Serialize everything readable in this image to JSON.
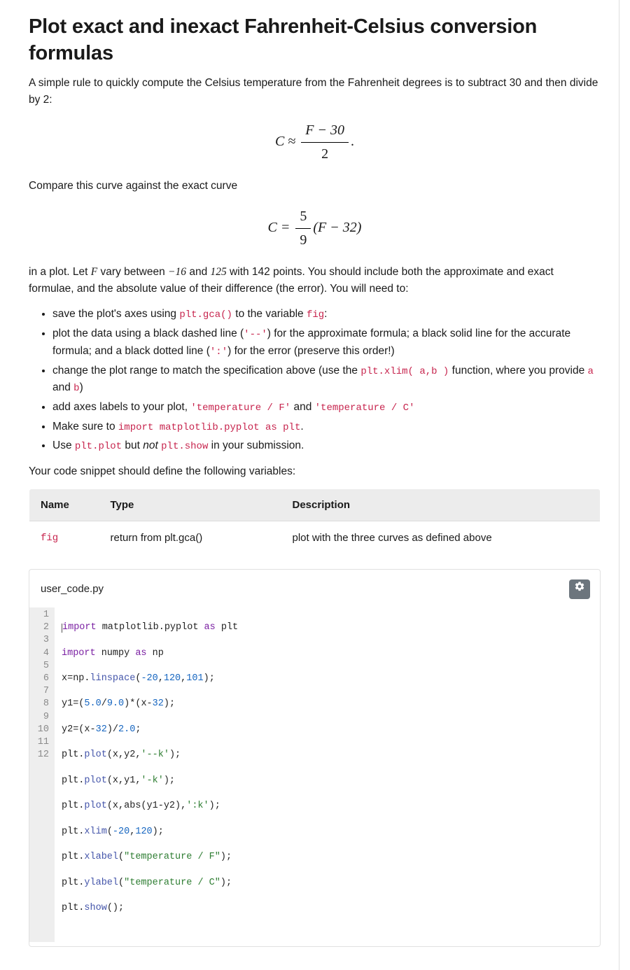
{
  "title": "Plot exact and inexact Fahrenheit-Celsius conversion formulas",
  "intro": "A simple rule to quickly compute the Celsius temperature from the Fahrenheit degrees is to subtract 30 and then divide by 2:",
  "eq1": {
    "lhs": "C ≈",
    "num": "F − 30",
    "den": "2",
    "tail": "."
  },
  "compare": "Compare this curve against the exact curve",
  "eq2": {
    "lhs": "C =",
    "num": "5",
    "den": "9",
    "rhs": "(F − 32)"
  },
  "range": {
    "pre": "in a plot. Let ",
    "var": "F",
    "mid1": " vary between ",
    "lo": "−16",
    "mid2": " and ",
    "hi": "125",
    "rest": " with 142 points. You should include both the approximate and exact formulae, and the absolute value of their difference (the error). You will need to:"
  },
  "codebits": {
    "gca": "plt.gca()",
    "fig": "fig",
    "dashes": "'--'",
    "dots": "':'",
    "xlim": "plt.xlim( a,b )",
    "a": "a",
    "b": "b",
    "lblF": "'temperature / F'",
    "lblC": "'temperature / C'",
    "import": "import matplotlib.pyplot as plt",
    "pltplot": "plt.plot",
    "pltshow": "plt.show"
  },
  "b1a": "save the plot's axes using ",
  "b1b": " to the variable ",
  "b1c": ":",
  "b2a": "plot the data using a black dashed line (",
  "b2b": ") for the approximate formula; a black solid line for the accurate formula; and a black dotted line (",
  "b2c": ") for the error (preserve this order!)",
  "b3a": "change the plot range to match the specification above (use the ",
  "b3b": " function, where you provide ",
  "b3c": " and ",
  "b3d": ")",
  "b4a": "add axes labels to your plot, ",
  "b4b": " and ",
  "b5a": "Make sure to ",
  "b5b": ".",
  "b6a": "Use ",
  "b6b": " but ",
  "b6not": "not",
  "b6c": " in your submission.",
  "define": "Your code snippet should define the following variables:",
  "table": {
    "h1": "Name",
    "h2": "Type",
    "h3": "Description",
    "r1": {
      "name": "fig",
      "type": "return from plt.gca()",
      "desc": "plot with the three curves as defined above"
    }
  },
  "file": "user_code.py",
  "lines": [
    "1",
    "2",
    "3",
    "4",
    "5",
    "6",
    "7",
    "8",
    "9",
    "10",
    "11",
    "12"
  ],
  "code": {
    "l1a": "import",
    "l1b": " matplotlib.pyplot ",
    "l1c": "as",
    "l1d": " plt",
    "l2a": "import",
    "l2b": " numpy ",
    "l2c": "as",
    "l2d": " np",
    "l3a": "x=np.",
    "l3b": "linspace",
    "l3c": "(",
    "l3n1": "-20",
    "l3d": ",",
    "l3n2": "120",
    "l3e": ",",
    "l3n3": "101",
    "l3f": ");",
    "l4a": "y1=(",
    "l4n1": "5.0",
    "l4b": "/",
    "l4n2": "9.0",
    "l4c": ")*(x-",
    "l4n3": "32",
    "l4d": ");",
    "l5a": "y2=(x-",
    "l5n1": "32",
    "l5b": ")/",
    "l5n2": "2.0",
    "l5c": ";",
    "l6a": "plt.",
    "l6b": "plot",
    "l6c": "(x,y2,",
    "l6s": "'--k'",
    "l6d": ");",
    "l7a": "plt.",
    "l7b": "plot",
    "l7c": "(x,y1,",
    "l7s": "'-k'",
    "l7d": ");",
    "l8a": "plt.",
    "l8b": "plot",
    "l8c": "(x,abs(y1-y2),",
    "l8s": "':k'",
    "l8d": ");",
    "l9a": "plt.",
    "l9b": "xlim",
    "l9c": "(",
    "l9n1": "-20",
    "l9d": ",",
    "l9n2": "120",
    "l9e": ");",
    "l10a": "plt.",
    "l10b": "xlabel",
    "l10c": "(",
    "l10s": "\"temperature / F\"",
    "l10d": ");",
    "l11a": "plt.",
    "l11b": "ylabel",
    "l11c": "(",
    "l11s": "\"temperature / C\"",
    "l11d": ");",
    "l12a": "plt.",
    "l12b": "show",
    "l12c": "();"
  }
}
